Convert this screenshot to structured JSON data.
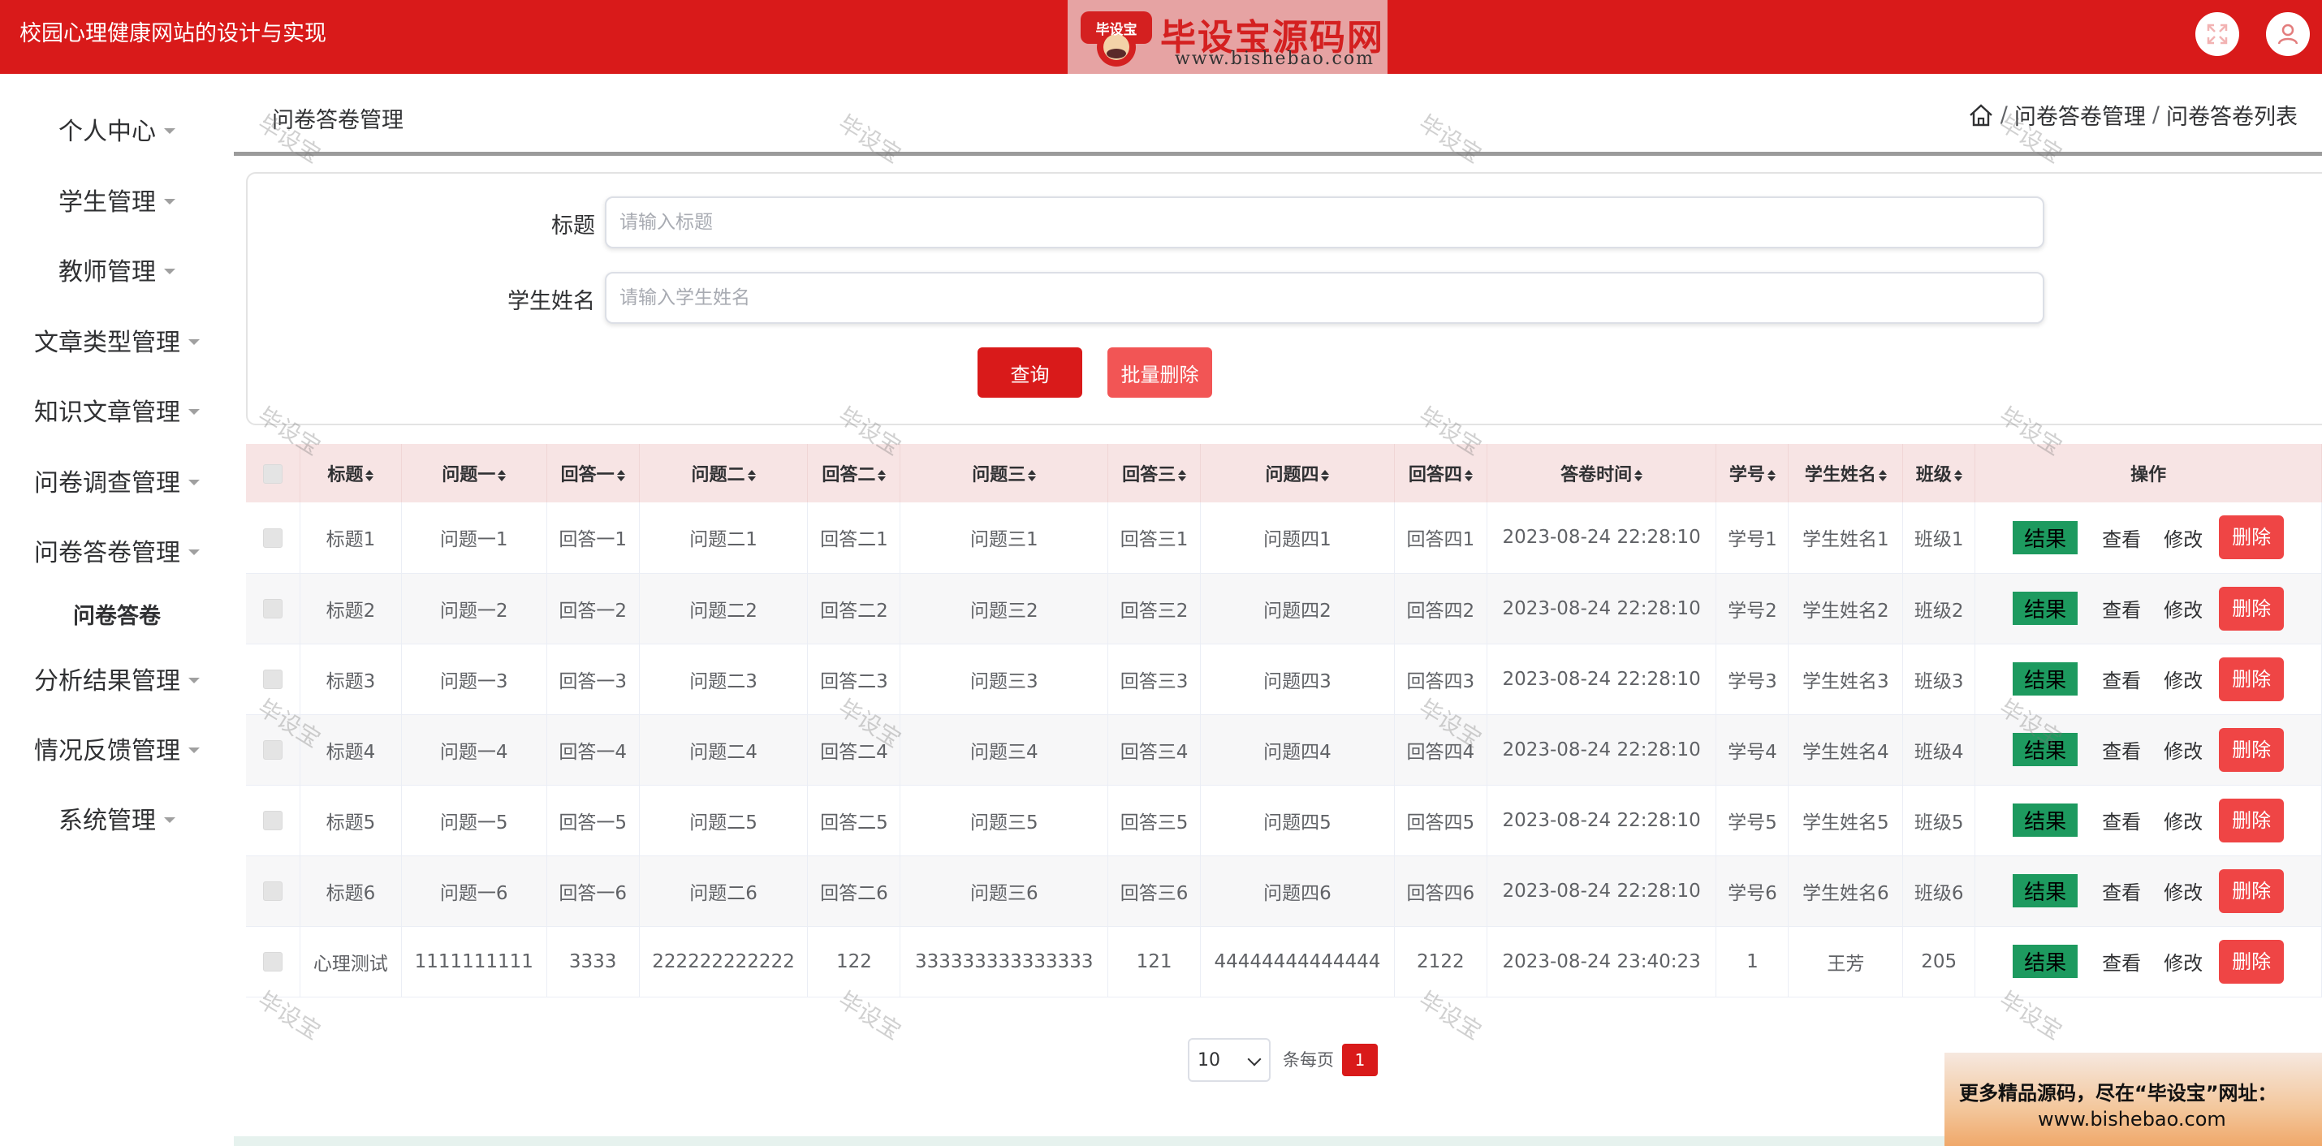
{
  "header": {
    "app_title": "校园心理健康网站的设计与实现",
    "logo_text": "毕设宝源码网",
    "logo_url": "www.bishebao.com",
    "logo_badge": "毕设宝",
    "fullscreen_icon": "expand-icon",
    "user_icon": "user-icon",
    "color": "#d91a1a"
  },
  "sidebar": {
    "items": [
      {
        "label": "个人中心"
      },
      {
        "label": "学生管理"
      },
      {
        "label": "教师管理"
      },
      {
        "label": "文章类型管理"
      },
      {
        "label": "知识文章管理"
      },
      {
        "label": "问卷调查管理"
      },
      {
        "label": "问卷答卷管理"
      },
      {
        "label": "分析结果管理"
      },
      {
        "label": "情况反馈管理"
      },
      {
        "label": "系统管理"
      }
    ],
    "active_sub": "问卷答卷"
  },
  "page": {
    "title": "问卷答卷管理",
    "breadcrumb": [
      "问卷答卷管理",
      "问卷答卷列表"
    ],
    "breadcrumb_sep": "/"
  },
  "search": {
    "title_label": "标题",
    "title_placeholder": "请输入标题",
    "name_label": "学生姓名",
    "name_placeholder": "请输入学生姓名",
    "query_button": "查询",
    "batch_delete_button": "批量删除"
  },
  "table": {
    "columns": [
      "标题",
      "问题一",
      "回答一",
      "问题二",
      "回答二",
      "问题三",
      "回答三",
      "问题四",
      "回答四",
      "答卷时间",
      "学号",
      "学生姓名",
      "班级",
      "操作"
    ],
    "rows": [
      [
        "标题1",
        "问题一1",
        "回答一1",
        "问题二1",
        "回答二1",
        "问题三1",
        "回答三1",
        "问题四1",
        "回答四1",
        "2023-08-24 22:28:10",
        "学号1",
        "学生姓名1",
        "班级1"
      ],
      [
        "标题2",
        "问题一2",
        "回答一2",
        "问题二2",
        "回答二2",
        "问题三2",
        "回答三2",
        "问题四2",
        "回答四2",
        "2023-08-24 22:28:10",
        "学号2",
        "学生姓名2",
        "班级2"
      ],
      [
        "标题3",
        "问题一3",
        "回答一3",
        "问题二3",
        "回答二3",
        "问题三3",
        "回答三3",
        "问题四3",
        "回答四3",
        "2023-08-24 22:28:10",
        "学号3",
        "学生姓名3",
        "班级3"
      ],
      [
        "标题4",
        "问题一4",
        "回答一4",
        "问题二4",
        "回答二4",
        "问题三4",
        "回答三4",
        "问题四4",
        "回答四4",
        "2023-08-24 22:28:10",
        "学号4",
        "学生姓名4",
        "班级4"
      ],
      [
        "标题5",
        "问题一5",
        "回答一5",
        "问题二5",
        "回答二5",
        "问题三5",
        "回答三5",
        "问题四5",
        "回答四5",
        "2023-08-24 22:28:10",
        "学号5",
        "学生姓名5",
        "班级5"
      ],
      [
        "标题6",
        "问题一6",
        "回答一6",
        "问题二6",
        "回答二6",
        "问题三6",
        "回答三6",
        "问题四6",
        "回答四6",
        "2023-08-24 22:28:10",
        "学号6",
        "学生姓名6",
        "班级6"
      ],
      [
        "心理测试",
        "1111111111",
        "3333",
        "222222222222",
        "122",
        "333333333333333",
        "121",
        "44444444444444",
        "2122",
        "2023-08-24 23:40:23",
        "1",
        "王芳",
        "205"
      ]
    ],
    "actions": {
      "result": "结果",
      "view": "查看",
      "edit": "修改",
      "delete": "删除"
    }
  },
  "pagination": {
    "page_size": "10",
    "per_page_label": "条每页",
    "current_page": "1"
  },
  "promo": {
    "line1": "更多精品源码，尽在“毕设宝”网址：",
    "line2": "www.bishebao.com"
  },
  "watermark": "毕设宝"
}
